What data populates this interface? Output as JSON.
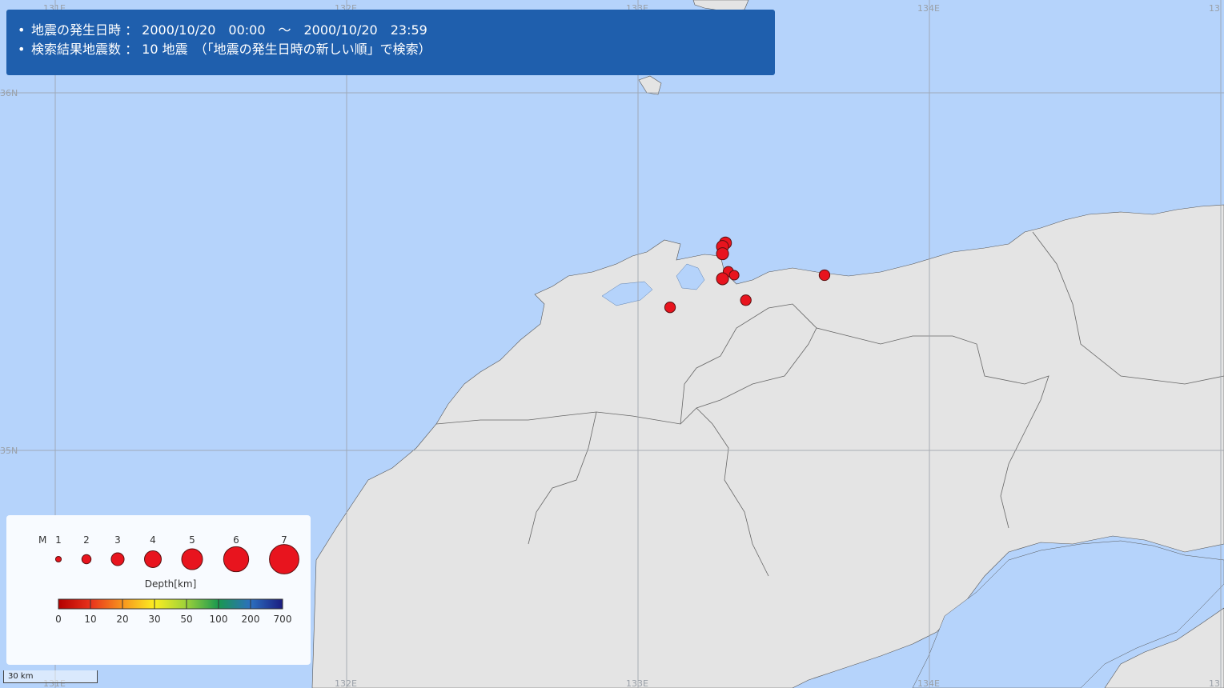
{
  "info": {
    "line1": "地震の発生日時 ： 2000/10/20　00:00　～　2000/10/20　23:59",
    "line2": "検索結果地震数 ： 10 地震　（「地震の発生日時の新しい順」で検索）"
  },
  "grid_labels": {
    "lon_top": [
      "131E",
      "132E",
      "133E",
      "134E",
      "13"
    ],
    "lat_left": [
      "36N",
      "35N"
    ],
    "lon_bottom": [
      "131E",
      "132E",
      "133E",
      "134E",
      "13"
    ]
  },
  "legend": {
    "magnitude_label": "M",
    "magnitudes": [
      "1",
      "2",
      "3",
      "4",
      "5",
      "6",
      "7"
    ],
    "depth_title": "Depth[km]",
    "depth_ticks": [
      "0",
      "10",
      "20",
      "30",
      "50",
      "100",
      "200",
      "700"
    ],
    "depth_colors": [
      "#b30000",
      "#e8321c",
      "#f7941d",
      "#fcee21",
      "#9bd13a",
      "#1a9850",
      "#2c6fbf",
      "#1c1c80"
    ]
  },
  "scale_bar": "30 km",
  "colors": {
    "sea": "#b5d3fb",
    "land": "#e6e6e6",
    "panel": "#1f5fad",
    "epicenter": "#e8141e"
  },
  "epicenters": [
    {
      "lon": 133.3,
      "lat": 35.58,
      "mag": 3.0
    },
    {
      "lon": 133.29,
      "lat": 35.57,
      "mag": 3.0
    },
    {
      "lon": 133.29,
      "lat": 35.55,
      "mag": 3.0
    },
    {
      "lon": 133.31,
      "lat": 35.5,
      "mag": 2.5
    },
    {
      "lon": 133.33,
      "lat": 35.49,
      "mag": 2.3
    },
    {
      "lon": 133.29,
      "lat": 35.48,
      "mag": 3.0
    },
    {
      "lon": 133.37,
      "lat": 35.42,
      "mag": 2.6
    },
    {
      "lon": 133.64,
      "lat": 35.49,
      "mag": 2.6
    },
    {
      "lon": 133.11,
      "lat": 35.4,
      "mag": 2.6
    }
  ]
}
